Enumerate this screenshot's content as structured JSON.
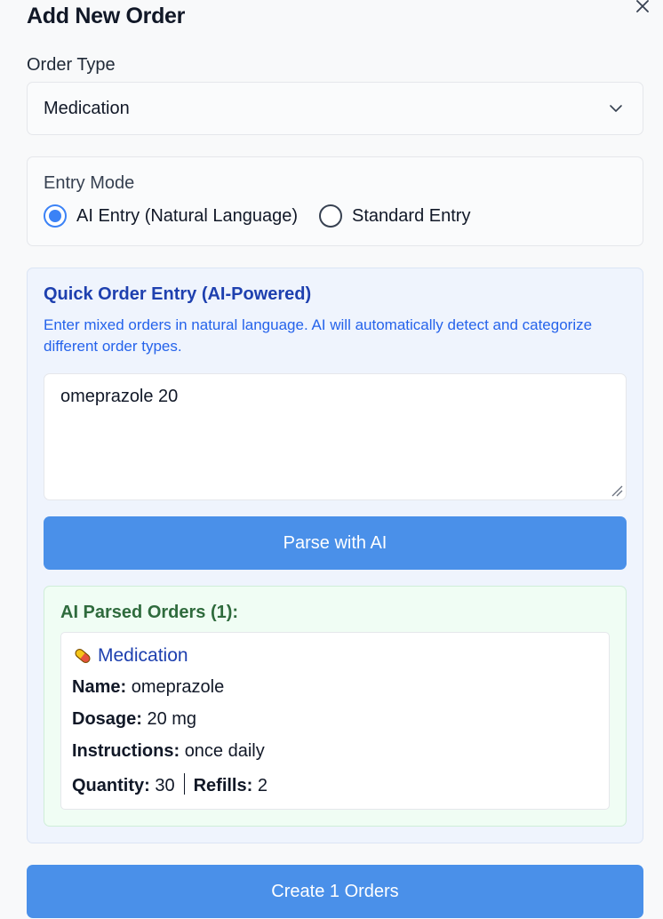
{
  "modal": {
    "title": "Add New Order"
  },
  "order_type": {
    "label": "Order Type",
    "value": "Medication"
  },
  "entry_mode": {
    "label": "Entry Mode",
    "options": [
      {
        "label": "AI Entry (Natural Language)",
        "selected": true
      },
      {
        "label": "Standard Entry",
        "selected": false
      }
    ]
  },
  "ai_panel": {
    "title": "Quick Order Entry (AI-Powered)",
    "description": "Enter mixed orders in natural language. AI will automatically detect and categorize different order types.",
    "input_value": "omeprazole 20",
    "parse_button": "Parse with AI",
    "parsed": {
      "title": "AI Parsed Orders (1):",
      "orders": [
        {
          "icon": "pill-icon",
          "type": "Medication",
          "name_label": "Name:",
          "name": "omeprazole",
          "dosage_label": "Dosage:",
          "dosage": "20 mg",
          "instructions_label": "Instructions:",
          "instructions": "once daily",
          "quantity_label": "Quantity:",
          "quantity": "30",
          "refills_label": "Refills:",
          "refills": "2"
        }
      ]
    }
  },
  "footer": {
    "create_button": "Create 1 Orders"
  },
  "colors": {
    "accent": "#4a90e9",
    "ai_title": "#1e40af",
    "parsed_title": "#2f6b3d"
  }
}
